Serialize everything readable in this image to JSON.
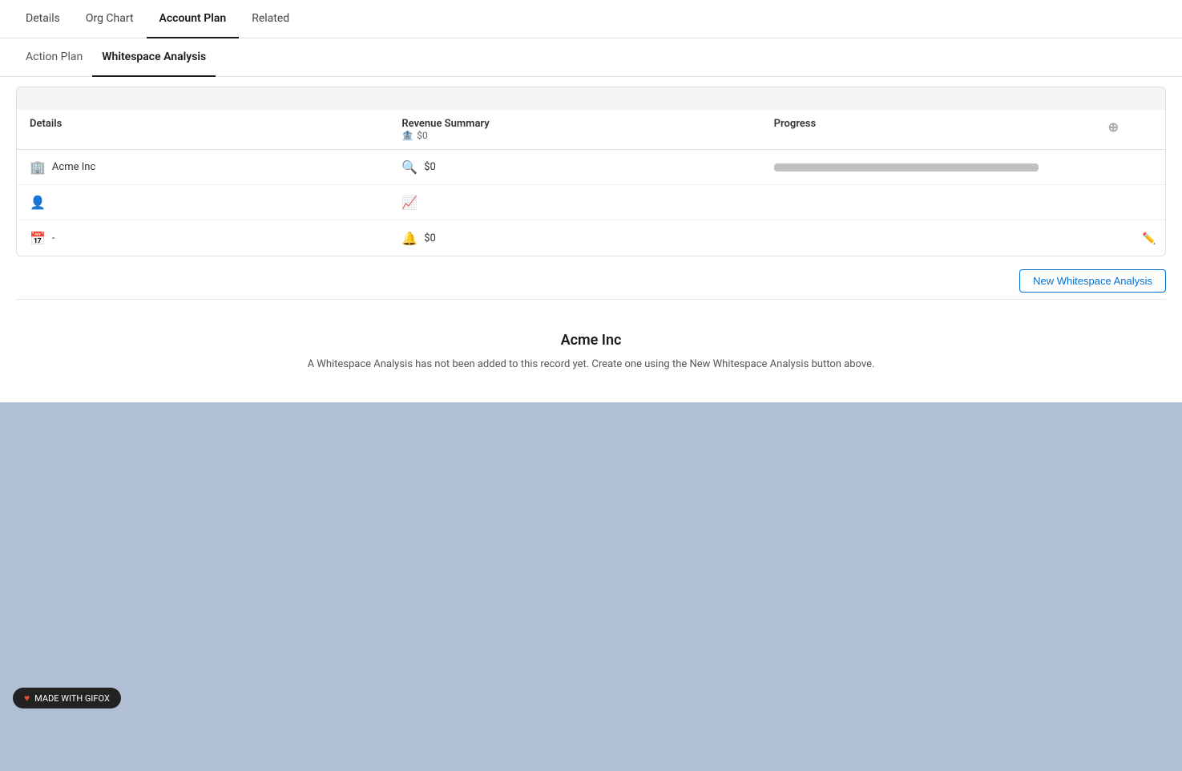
{
  "topNav": {
    "tabs": [
      {
        "id": "details",
        "label": "Details",
        "active": false
      },
      {
        "id": "org-chart",
        "label": "Org Chart",
        "active": false
      },
      {
        "id": "account-plan",
        "label": "Account Plan",
        "active": true
      },
      {
        "id": "related",
        "label": "Related",
        "active": false
      }
    ]
  },
  "subTabs": {
    "tabs": [
      {
        "id": "action-plan",
        "label": "Action Plan",
        "active": false
      },
      {
        "id": "whitespace-analysis",
        "label": "Whitespace Analysis",
        "active": true
      }
    ]
  },
  "table": {
    "columns": {
      "details": "Details",
      "revenueSummary": "Revenue Summary",
      "revenueSub": "$0",
      "progress": "Progress"
    },
    "rows": [
      {
        "detailsIcon": "🏢",
        "detailsText": "Acme Inc",
        "revenueIcon": "🔍",
        "revenueValue": "$0",
        "progressWidth": "100",
        "showProgress": true
      },
      {
        "detailsIcon": "👤",
        "detailsText": "",
        "revenueIcon": "📈",
        "revenueValue": "",
        "progressWidth": "0",
        "showProgress": false
      },
      {
        "detailsIcon": "📅",
        "detailsText": "-",
        "revenueIcon": "🔔",
        "revenueValue": "$0",
        "progressWidth": "0",
        "showProgress": false
      }
    ]
  },
  "newWsButton": "New Whitespace Analysis",
  "emptyState": {
    "title": "Acme Inc",
    "message": "A Whitespace Analysis has not been added to this record yet. Create one using the New Whitespace Analysis button above."
  },
  "gifoxBadge": {
    "text": "MADE WITH GIFOX"
  }
}
